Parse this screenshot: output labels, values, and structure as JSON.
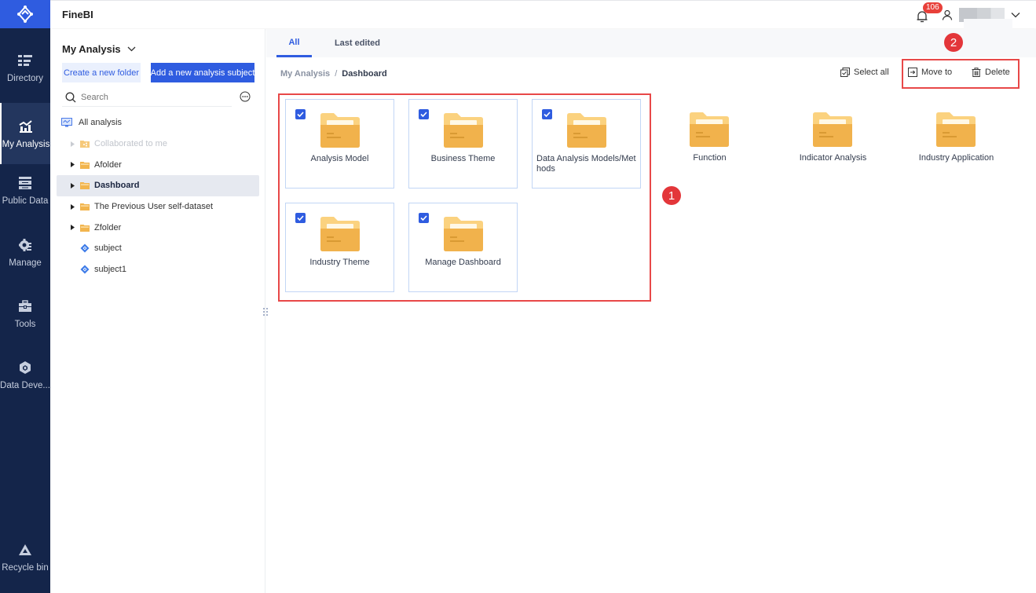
{
  "app": {
    "title": "FineBI"
  },
  "topbar": {
    "notification_count": "106",
    "user_name": ""
  },
  "nav": {
    "items": [
      {
        "label": "Directory",
        "icon": "directory-icon",
        "active": false
      },
      {
        "label": "My Analysis",
        "icon": "analysis-chart-icon",
        "active": true
      },
      {
        "label": "Public Data",
        "icon": "public-data-icon",
        "active": false
      },
      {
        "label": "Manage",
        "icon": "manage-gear-icon",
        "active": false
      },
      {
        "label": "Tools",
        "icon": "toolbox-icon",
        "active": false
      },
      {
        "label": "Data Deve...",
        "icon": "data-development-icon",
        "active": false
      }
    ],
    "bottom": {
      "label": "Recycle bin",
      "icon": "recycle-bin-icon"
    }
  },
  "panel": {
    "title": "My Analysis",
    "new_folder_label": "Create a new folder",
    "new_subject_label": "Add a new analysis subject",
    "search_placeholder": "Search",
    "tree": {
      "root": "All analysis",
      "items": [
        {
          "label": "Collaborated to me",
          "type": "shared-folder",
          "expandable": true,
          "disabled": true,
          "selected": false
        },
        {
          "label": "Afolder",
          "type": "folder",
          "expandable": true,
          "disabled": false,
          "selected": false
        },
        {
          "label": "Dashboard",
          "type": "folder",
          "expandable": true,
          "disabled": false,
          "selected": true
        },
        {
          "label": "The Previous User self-dataset",
          "type": "folder",
          "expandable": true,
          "disabled": false,
          "selected": false
        },
        {
          "label": "Zfolder",
          "type": "folder",
          "expandable": true,
          "disabled": false,
          "selected": false
        },
        {
          "label": "subject",
          "type": "subject",
          "expandable": false,
          "disabled": false,
          "selected": false
        },
        {
          "label": "subject1",
          "type": "subject",
          "expandable": false,
          "disabled": false,
          "selected": false
        }
      ]
    }
  },
  "main": {
    "tabs": [
      {
        "label": "All",
        "active": true
      },
      {
        "label": "Last edited",
        "active": false
      }
    ],
    "breadcrumb": {
      "root": "My Analysis",
      "separator": "/",
      "current": "Dashboard"
    },
    "actions": {
      "select_all": "Select all",
      "move_to": "Move to",
      "delete": "Delete"
    },
    "folders": [
      {
        "name": "Analysis Model",
        "checked": true
      },
      {
        "name": "Business Theme",
        "checked": true
      },
      {
        "name": "Data Analysis Models/Methods",
        "checked": true
      },
      {
        "name": "Function",
        "checked": false
      },
      {
        "name": "Indicator Analysis",
        "checked": false
      },
      {
        "name": "Industry Application",
        "checked": false
      },
      {
        "name": "Industry Theme",
        "checked": true
      },
      {
        "name": "Manage Dashboard",
        "checked": true
      }
    ],
    "annotations": {
      "marker1": "1",
      "marker2": "2"
    }
  },
  "colors": {
    "accent": "#2f5ce0",
    "nav_bg": "#14254a",
    "highlight": "#e84848",
    "folder": "#f2b54e"
  }
}
